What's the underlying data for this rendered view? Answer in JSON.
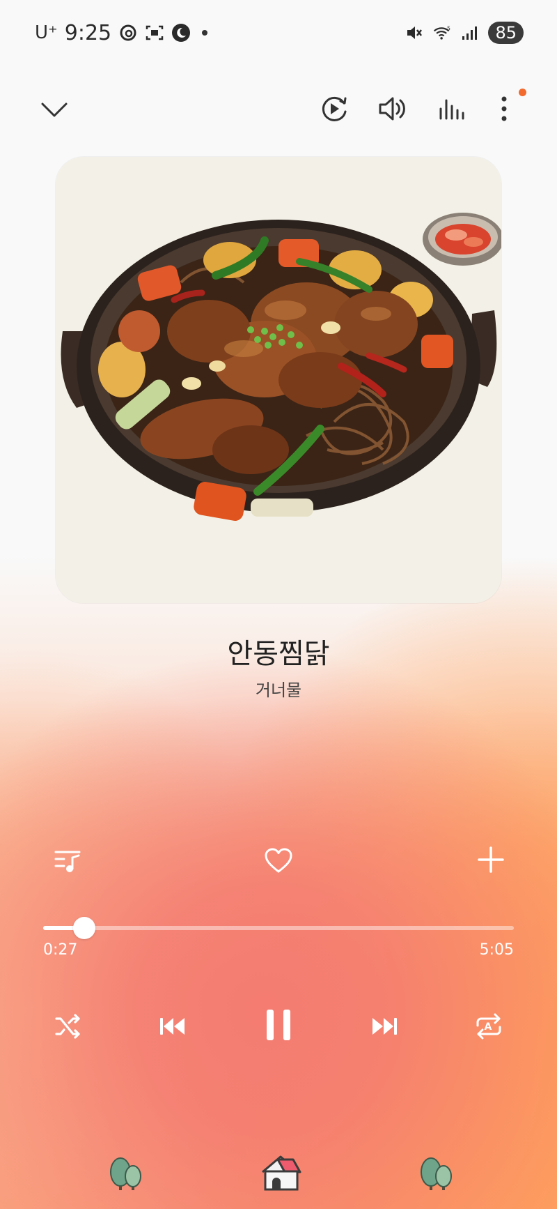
{
  "status_bar": {
    "carrier": "U⁺",
    "time": "9:25",
    "battery": "85"
  },
  "track": {
    "title": "안동찜닭",
    "artist": "거너물"
  },
  "progress": {
    "current": "0:27",
    "total": "5:05",
    "fraction": 0.088
  },
  "top_controls": [
    "collapse-icon",
    "mini-player-icon",
    "volume-icon",
    "equalizer-icon",
    "more-options-icon"
  ],
  "actions": [
    "playlist-icon",
    "heart-icon",
    "add-icon"
  ],
  "playback": [
    "shuffle-icon",
    "previous-icon",
    "pause-icon",
    "next-icon",
    "repeat-icon"
  ],
  "bottom_nav": [
    "forest-icon",
    "home-icon",
    "forest-icon"
  ],
  "colors": {
    "accent_dot": "#f26a2d",
    "gradient_pink": "#f47c71",
    "gradient_orange": "#ffa05a"
  }
}
